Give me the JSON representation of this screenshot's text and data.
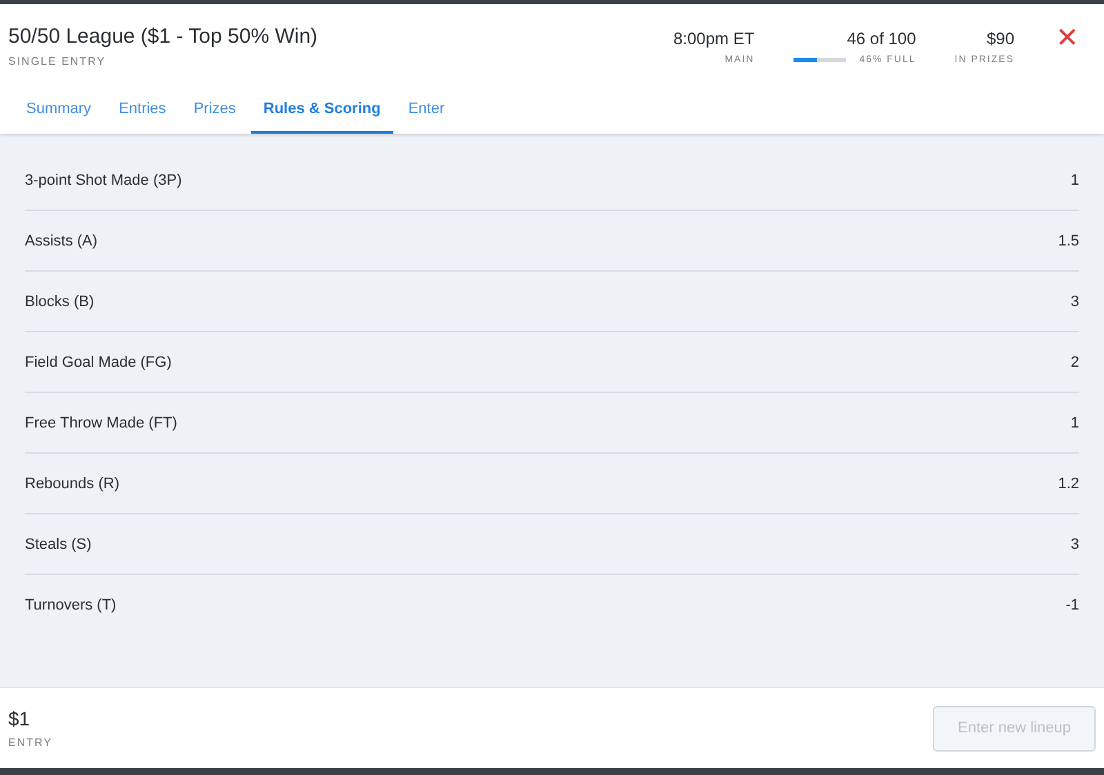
{
  "header": {
    "title": "50/50 League ($1 - Top 50% Win)",
    "subtitle": "SINGLE ENTRY",
    "stats": [
      {
        "kind": "text",
        "value": "8:00pm ET",
        "label": "MAIN"
      },
      {
        "kind": "progress",
        "value": "46 of 100",
        "label": "46% FULL",
        "level": 0.46
      },
      {
        "kind": "text",
        "value": "$90",
        "label": "IN PRIZES"
      }
    ],
    "close": "✕"
  },
  "tabs": [
    {
      "label": "Summary",
      "selected": false
    },
    {
      "label": "Entries",
      "selected": false
    },
    {
      "label": "Prizes",
      "selected": false
    },
    {
      "label": "Rules & Scoring",
      "selected": true
    },
    {
      "label": "Enter",
      "selected": false
    }
  ],
  "scoring": [
    {
      "stat": "3-point Shot Made (3P)",
      "points": "1"
    },
    {
      "stat": "Assists (A)",
      "points": "1.5"
    },
    {
      "stat": "Blocks (B)",
      "points": "3"
    },
    {
      "stat": "Field Goal Made (FG)",
      "points": "2"
    },
    {
      "stat": "Free Throw Made (FT)",
      "points": "1"
    },
    {
      "stat": "Rebounds (R)",
      "points": "1.2"
    },
    {
      "stat": "Steals (S)",
      "points": "3"
    },
    {
      "stat": "Turnovers (T)",
      "points": "-1"
    }
  ],
  "footer": {
    "fee": "$1",
    "fee_label": "ENTRY",
    "button": {
      "label": "Enter new lineup",
      "disabled": true
    }
  }
}
